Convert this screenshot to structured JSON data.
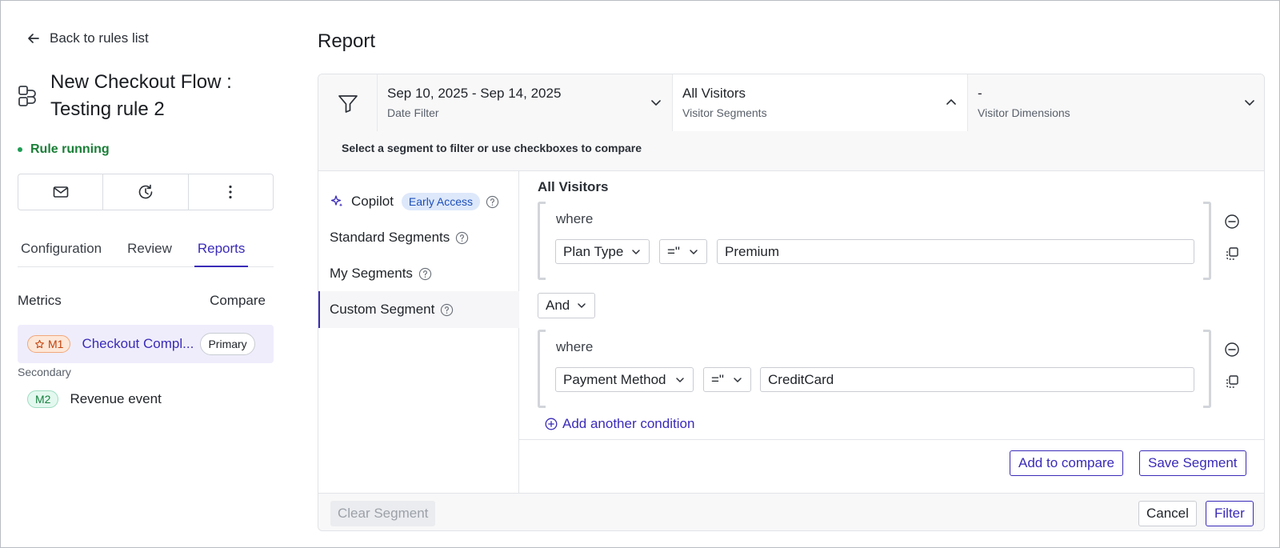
{
  "nav": {
    "back_label": "Back to rules list"
  },
  "rule": {
    "title": "New Checkout Flow : Testing rule 2",
    "status": "Rule running"
  },
  "tabs": [
    {
      "label": "Configuration",
      "active": false
    },
    {
      "label": "Review",
      "active": false
    },
    {
      "label": "Reports",
      "active": true
    }
  ],
  "metrics": {
    "header": "Metrics",
    "compare_label": "Compare",
    "primary": {
      "badge": "M1",
      "name": "Checkout Compl...",
      "pill": "Primary"
    },
    "secondary_label": "Secondary",
    "secondary": {
      "badge": "M2",
      "name": "Revenue event"
    }
  },
  "report": {
    "title": "Report",
    "filters": [
      {
        "value": "Sep 10, 2025 - Sep 14, 2025",
        "label": "Date Filter",
        "expanded": false
      },
      {
        "value": "All Visitors",
        "label": "Visitor Segments",
        "expanded": true
      },
      {
        "value": "-",
        "label": "Visitor Dimensions",
        "expanded": false
      }
    ],
    "hint": "Select a segment to filter or use checkboxes to compare",
    "segment_nav": {
      "copilot": "Copilot",
      "early_access": "Early Access",
      "standard": "Standard Segments",
      "mine": "My Segments",
      "custom": "Custom Segment"
    },
    "builder": {
      "title": "All Visitors",
      "conditions": [
        {
          "where": "where",
          "field": "Plan Type",
          "operator": "=\"",
          "value": "Premium"
        },
        {
          "where": "where",
          "field": "Payment Method",
          "operator": "=\"",
          "value": "CreditCard"
        }
      ],
      "joiner": "And",
      "add_condition": "Add another condition"
    },
    "buttons": {
      "add_to_compare": "Add to compare",
      "save_segment": "Save Segment",
      "clear_segment": "Clear Segment",
      "cancel": "Cancel",
      "filter": "Filter"
    }
  },
  "colors": {
    "accent": "#3a2bb8",
    "running": "#1a7f37"
  }
}
